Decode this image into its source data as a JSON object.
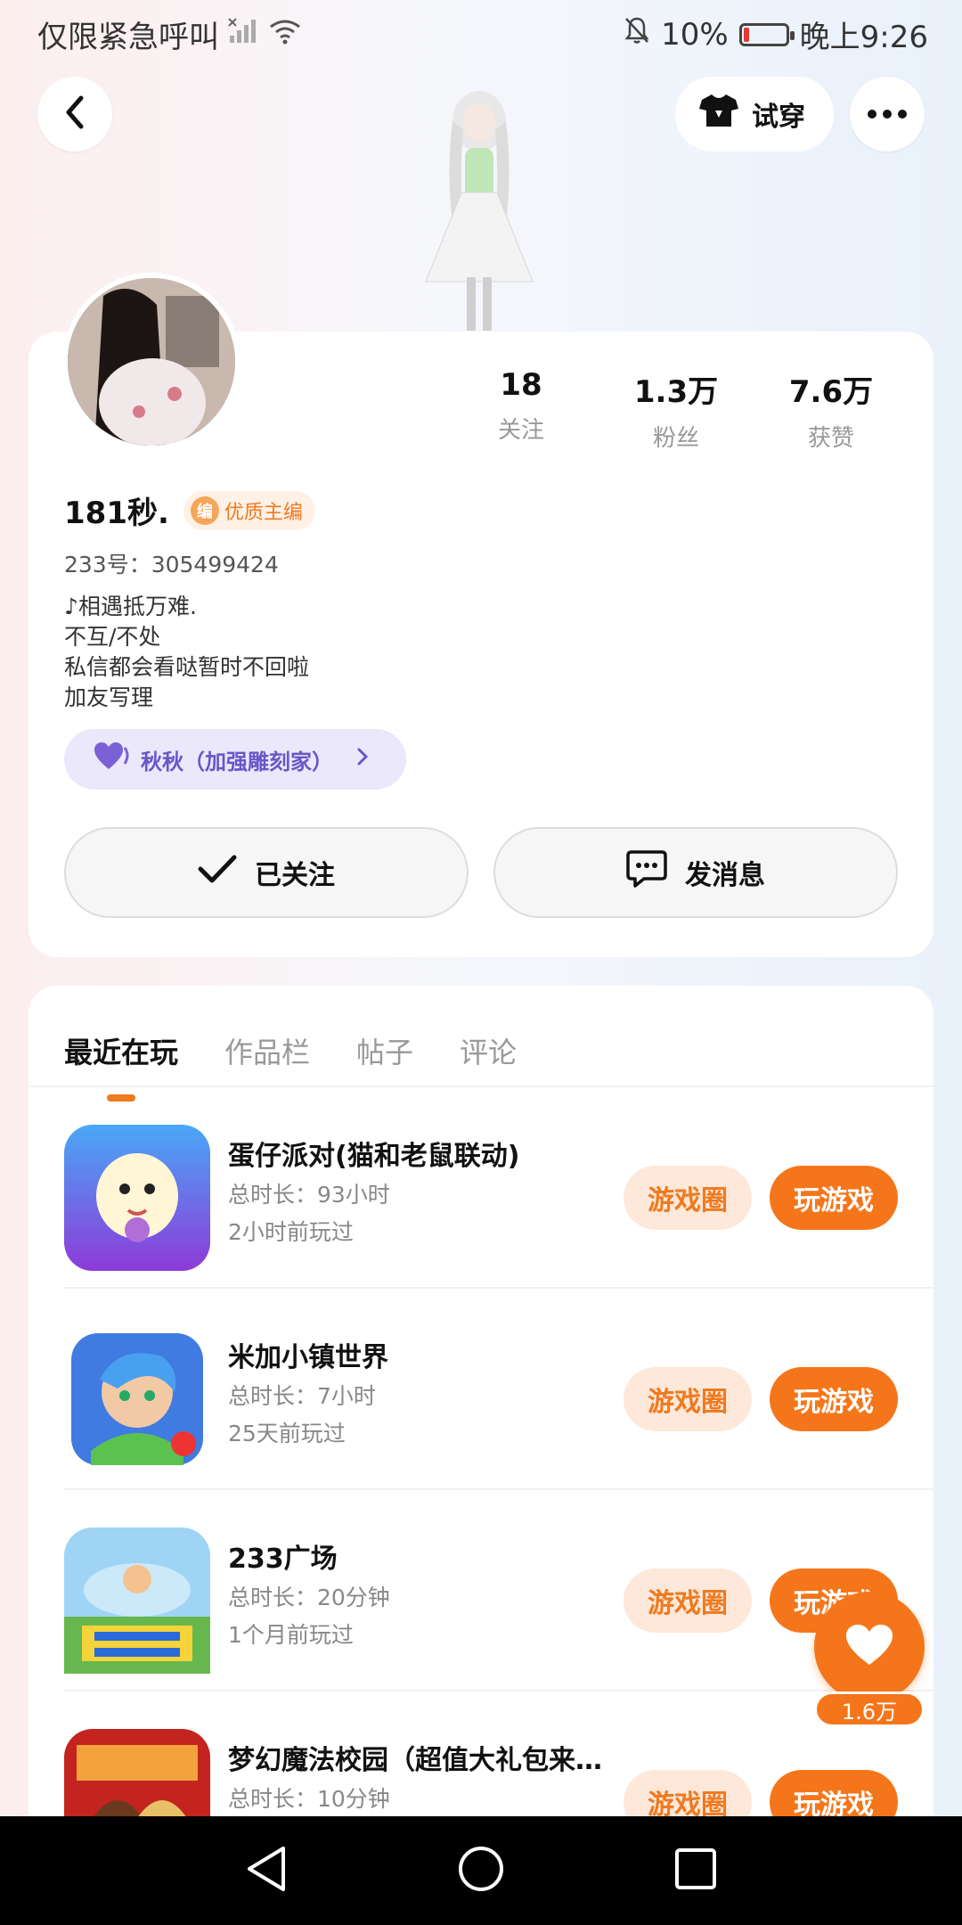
{
  "status_bar": {
    "carrier": "仅限紧急呼叫",
    "battery_percent": "10%",
    "time": "晚上9:26"
  },
  "top_bar": {
    "tryon_label": "试穿"
  },
  "profile": {
    "stats": [
      {
        "value": "18",
        "label": "关注"
      },
      {
        "value": "1.3万",
        "label": "粉丝"
      },
      {
        "value": "7.6万",
        "label": "获赞"
      }
    ],
    "name": "181秒.",
    "badge": "优质主编",
    "badge_icon_text": "编",
    "uid": "233号：305499424",
    "bio": [
      "♪相遇抵万难.",
      "不互/不处",
      "私信都会看哒暂时不回啦",
      "加友写理"
    ],
    "companion": "秋秋（加强雕刻家）",
    "follow_label": "已关注",
    "message_label": "发消息"
  },
  "tabs": [
    "最近在玩",
    "作品栏",
    "帖子",
    "评论"
  ],
  "games": [
    {
      "title": "蛋仔派对(猫和老鼠联动)",
      "duration": "总时长：93小时",
      "last_played": "2小时前玩过",
      "circle_label": "游戏圈",
      "play_label": "玩游戏"
    },
    {
      "title": "米加小镇世界",
      "duration": "总时长：7小时",
      "last_played": "25天前玩过",
      "circle_label": "游戏圈",
      "play_label": "玩游戏"
    },
    {
      "title": "233广场",
      "duration": "总时长：20分钟",
      "last_played": "1个月前玩过",
      "circle_label": "游戏圈",
      "play_label": "玩游戏"
    },
    {
      "title": "梦幻魔法校园（超值大礼包来...",
      "duration": "总时长：10分钟",
      "last_played": "",
      "circle_label": "游戏圈",
      "play_label": "玩游戏"
    }
  ],
  "like_fab": {
    "count": "1.6万"
  },
  "colors": {
    "accent": "#f5761a",
    "accent_soft": "#fde8da",
    "companion_bg": "#ece8fb",
    "companion_text": "#6a56c9"
  }
}
